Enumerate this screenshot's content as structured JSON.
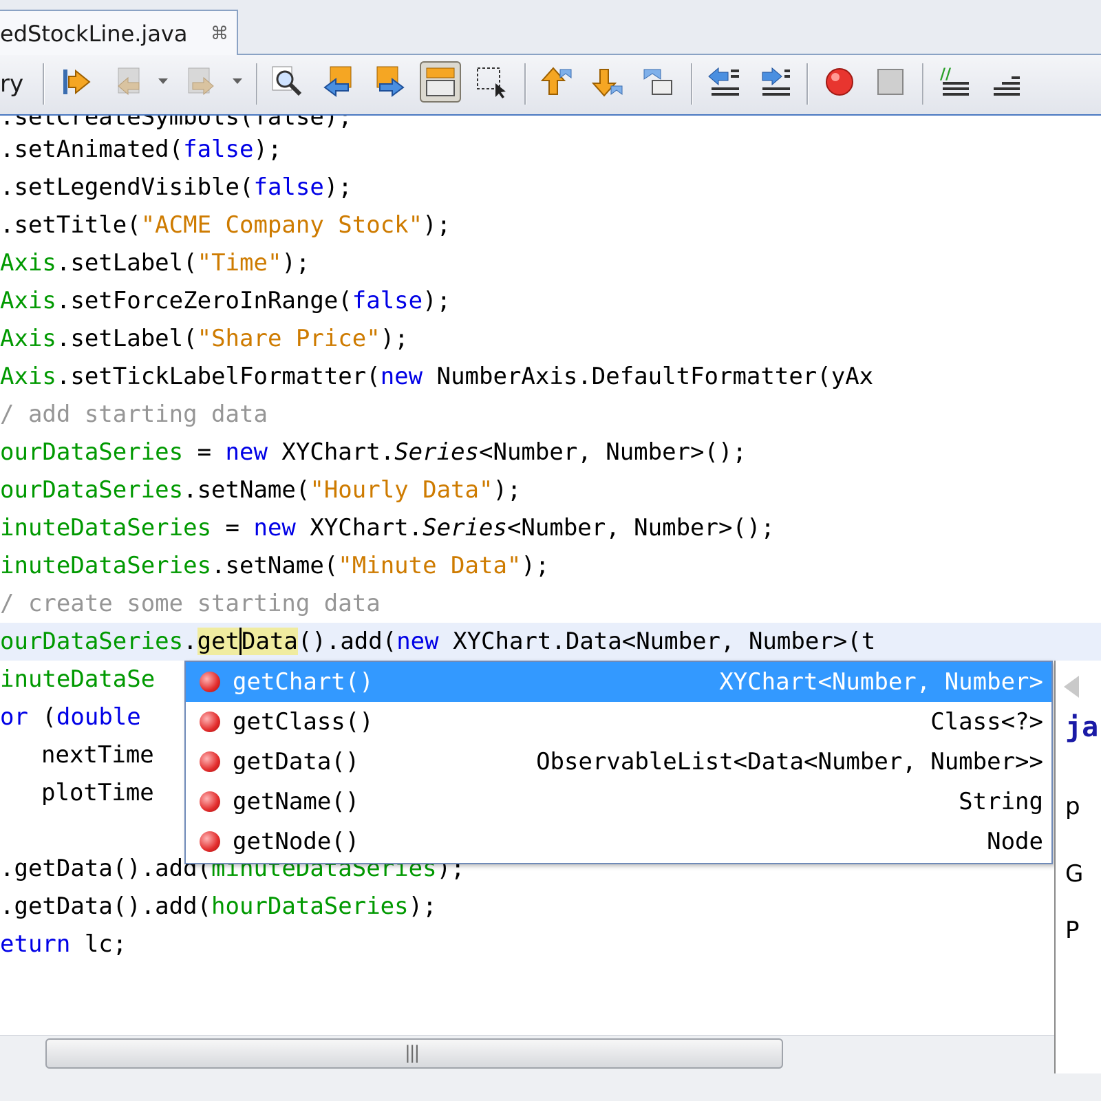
{
  "tab": {
    "label": "edStockLine.java",
    "close_glyph": "⌘"
  },
  "toolbar": {
    "prefix_text": "ry",
    "icons": [
      "last-edit-icon",
      "back-icon",
      "forward-icon",
      "find-icon",
      "find-previous-icon",
      "find-next-icon",
      "toggle-highlight-icon",
      "find-selection-icon",
      "previous-bookmark-icon",
      "next-bookmark-icon",
      "toggle-bookmark-icon",
      "shift-left-icon",
      "shift-right-icon",
      "start-macro-icon",
      "stop-macro-icon",
      "comment-icon",
      "uncomment-icon"
    ]
  },
  "code": {
    "l0": [
      ".setCreateSymbols(false);"
    ],
    "l1": [
      ".setAnimated(",
      "false",
      ");"
    ],
    "l2": [
      ".setLegendVisible(",
      "false",
      ");"
    ],
    "l3": [
      ".setTitle(",
      "\"ACME Company Stock\"",
      ");"
    ],
    "l4": [
      "Axis",
      ".setLabel(",
      "\"Time\"",
      ");"
    ],
    "l5": [
      "Axis",
      ".setForceZeroInRange(",
      "false",
      ");"
    ],
    "l6": [
      "Axis",
      ".setLabel(",
      "\"Share Price\"",
      ");"
    ],
    "l7": [
      "Axis",
      ".setTickLabelFormatter(",
      "new",
      " NumberAxis.DefaultFormatter(yAx"
    ],
    "l8": [
      "/ add starting data"
    ],
    "l9": [
      "ourDataSeries",
      " = ",
      "new",
      " XYChart.",
      "Series",
      "<Number, Number>();"
    ],
    "l10": [
      "ourDataSeries",
      ".setName(",
      "\"Hourly Data\"",
      ");"
    ],
    "l11": [
      "inuteDataSeries",
      " = ",
      "new",
      " XYChart.",
      "Series",
      "<Number, Number>();"
    ],
    "l12": [
      "inuteDataSeries",
      ".setName(",
      "\"Minute Data\"",
      ");"
    ],
    "l13": [
      "/ create some starting data"
    ],
    "l14": [
      "ourDataSeries",
      ".",
      "get",
      "Data",
      "().add(",
      "new",
      " XYChart.Data<Number, Number>(t"
    ],
    "l15": [
      "inuteDataSe"
    ],
    "l16": [
      "or",
      " (",
      "double",
      " "
    ],
    "l17": [
      "nextTime"
    ],
    "l18": [
      "plotTime"
    ],
    "l19": [
      ".getData().add(",
      "minuteDataSeries",
      ");"
    ],
    "l20": [
      ".getData().add(",
      "hourDataSeries",
      ");"
    ],
    "l21": [
      "eturn",
      " lc;"
    ]
  },
  "autocomplete": {
    "items": [
      {
        "name": "getChart()",
        "type": "XYChart<Number, Number>",
        "selected": true
      },
      {
        "name": "getClass()",
        "type": "Class<?>"
      },
      {
        "name": "getData()",
        "type": "ObservableList<Data<Number, Number>>"
      },
      {
        "name": "getName()",
        "type": "String"
      },
      {
        "name": "getNode()",
        "type": "Node"
      }
    ]
  },
  "doc_panel": {
    "t0": "ja",
    "t1": "p",
    "t2": "G",
    "t3": "P"
  },
  "colors": {
    "keyword": "#0000e6",
    "string": "#ce7b00",
    "field": "#009900",
    "comment": "#969696",
    "selection": "#3399ff"
  }
}
